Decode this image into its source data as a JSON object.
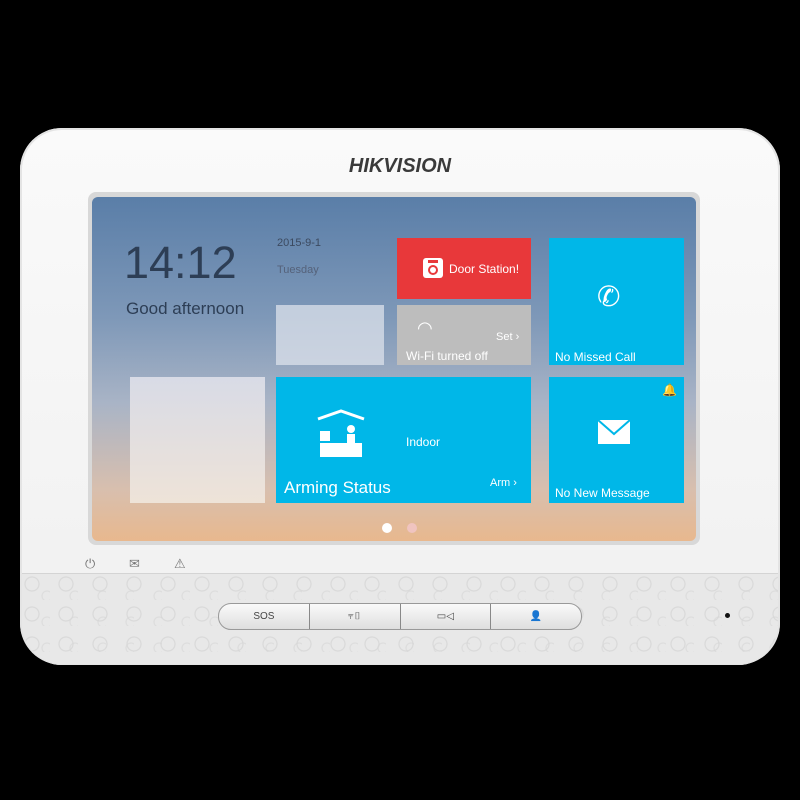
{
  "brand": "HIKVISION",
  "clock": {
    "time": "14:12",
    "greeting": "Good afternoon",
    "date": "2015-9-1",
    "weekday": "Tuesday"
  },
  "tiles": {
    "door_station": {
      "label": "Door Station!",
      "color": "#e8383a",
      "icon": "door-station-icon"
    },
    "wifi": {
      "label": "Wi-Fi turned off",
      "action": "Set",
      "icon": "wifi-icon"
    },
    "missed_call": {
      "label": "No Missed Call",
      "icon": "missed-call-icon"
    },
    "arming": {
      "title": "Arming Status",
      "mode": "Indoor",
      "action": "Arm",
      "icon": "indoor-arming-icon"
    },
    "message": {
      "label": "No New Message",
      "icon": "envelope-icon",
      "badge_icon": "bell-icon"
    }
  },
  "pager": {
    "pages": 2,
    "current": 1
  },
  "indicators": [
    "power-icon",
    "message-led-icon",
    "alarm-icon"
  ],
  "buttons": [
    {
      "label": "SOS"
    },
    {
      "icon": "unlock-key-icon"
    },
    {
      "icon": "camera-icon"
    },
    {
      "icon": "contacts-icon"
    }
  ],
  "colors": {
    "tile_blue": "#00b7e8",
    "tile_red": "#e8383a",
    "tile_gray": "#bdbdbd"
  }
}
